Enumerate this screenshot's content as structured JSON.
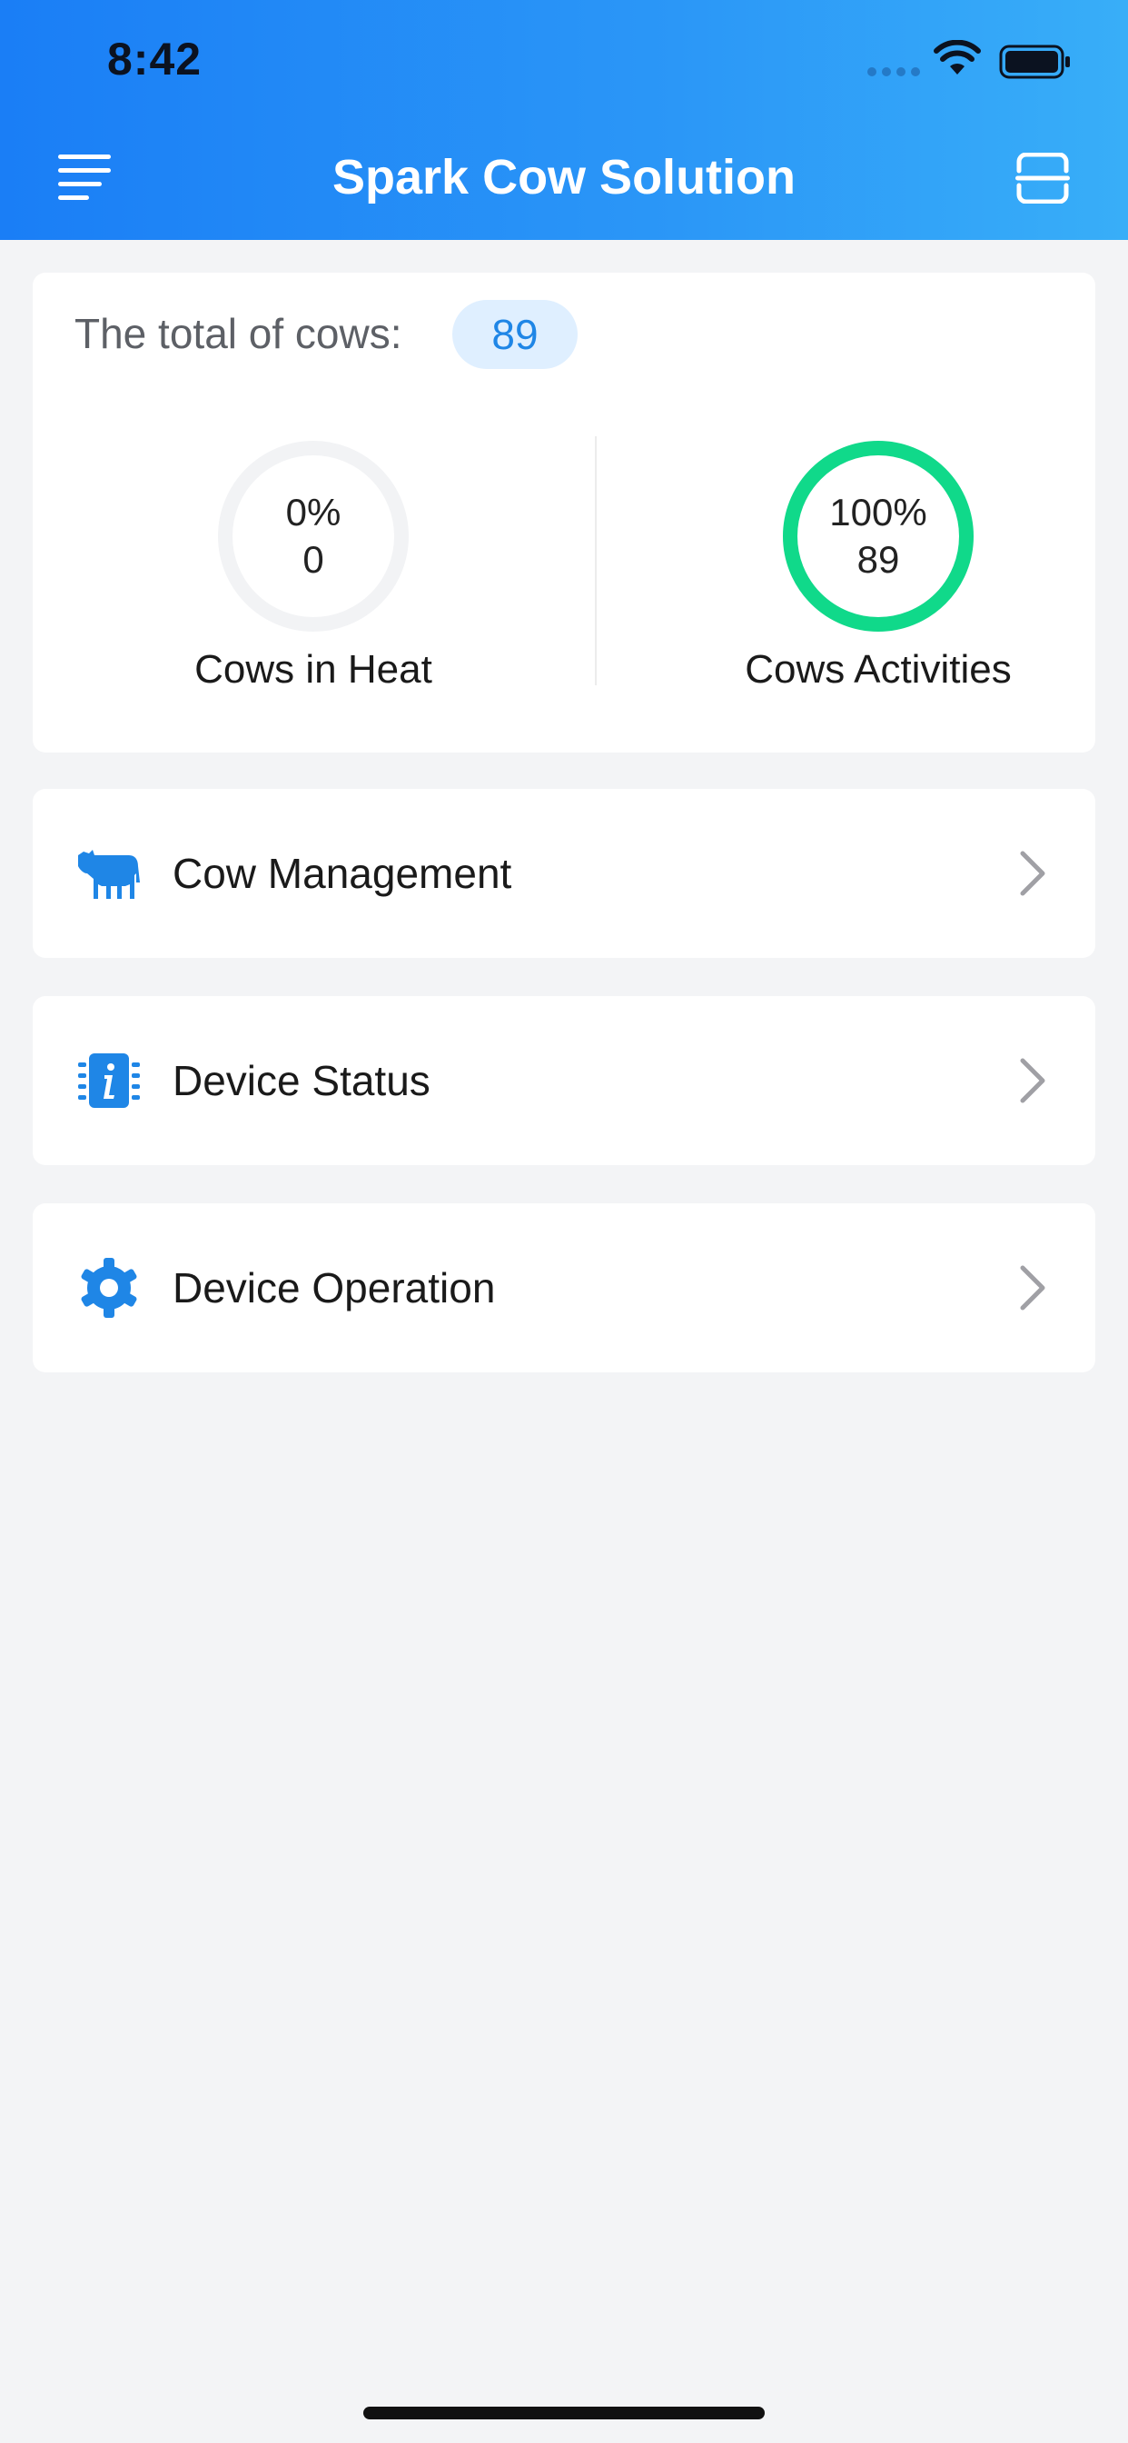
{
  "status_bar": {
    "time": "8:42"
  },
  "header": {
    "title": "Spark Cow Solution",
    "left_icon": "menu-icon",
    "right_icon": "scan-icon"
  },
  "stats": {
    "total_label": "The total of cows:",
    "total_value": "89",
    "heat": {
      "percent_text": "0%",
      "count_text": "0",
      "label": "Cows in Heat",
      "fraction": 0
    },
    "activities": {
      "percent_text": "100%",
      "count_text": "89",
      "label": "Cows Activities",
      "fraction": 1
    }
  },
  "menu": [
    {
      "label": "Cow Management",
      "icon": "cow-icon"
    },
    {
      "label": "Device Status",
      "icon": "device-info-icon"
    },
    {
      "label": "Device Operation",
      "icon": "gear-icon"
    }
  ],
  "colors": {
    "accent": "#1a7ef6",
    "ring_active": "#10d98a",
    "ring_track": "#f2f3f5",
    "badge_bg": "#dfefff",
    "badge_text": "#1f86e6"
  }
}
